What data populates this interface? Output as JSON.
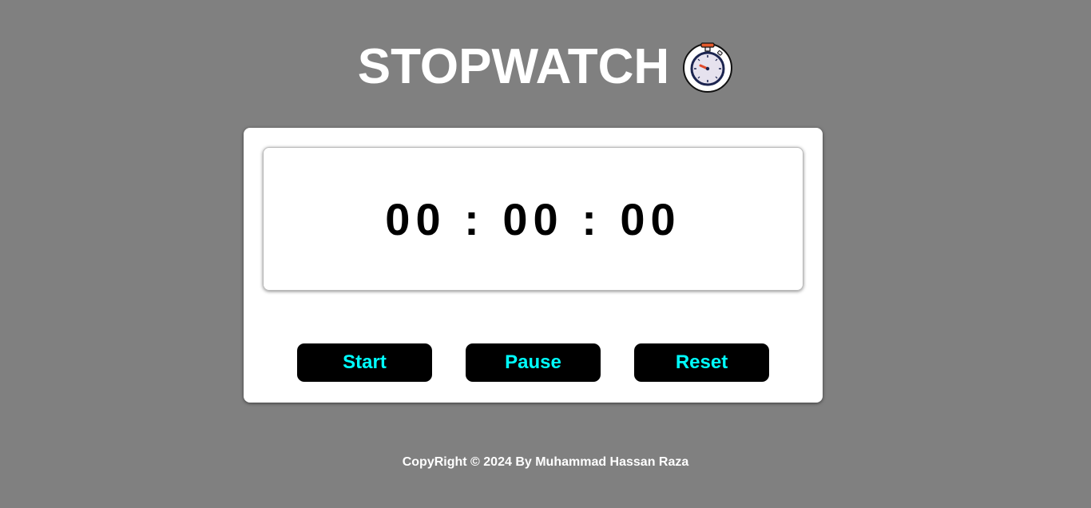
{
  "header": {
    "title": "STOPWATCH",
    "icon": "stopwatch-icon"
  },
  "display": {
    "time": "00 : 00 : 00"
  },
  "controls": {
    "start_label": "Start",
    "pause_label": "Pause",
    "reset_label": "Reset"
  },
  "footer": {
    "copyright": "CopyRight © 2024 By Muhammad Hassan Raza"
  },
  "colors": {
    "background": "#808080",
    "card": "#ffffff",
    "button_bg": "#000000",
    "button_text": "#00ffff",
    "title_text": "#ffffff"
  }
}
